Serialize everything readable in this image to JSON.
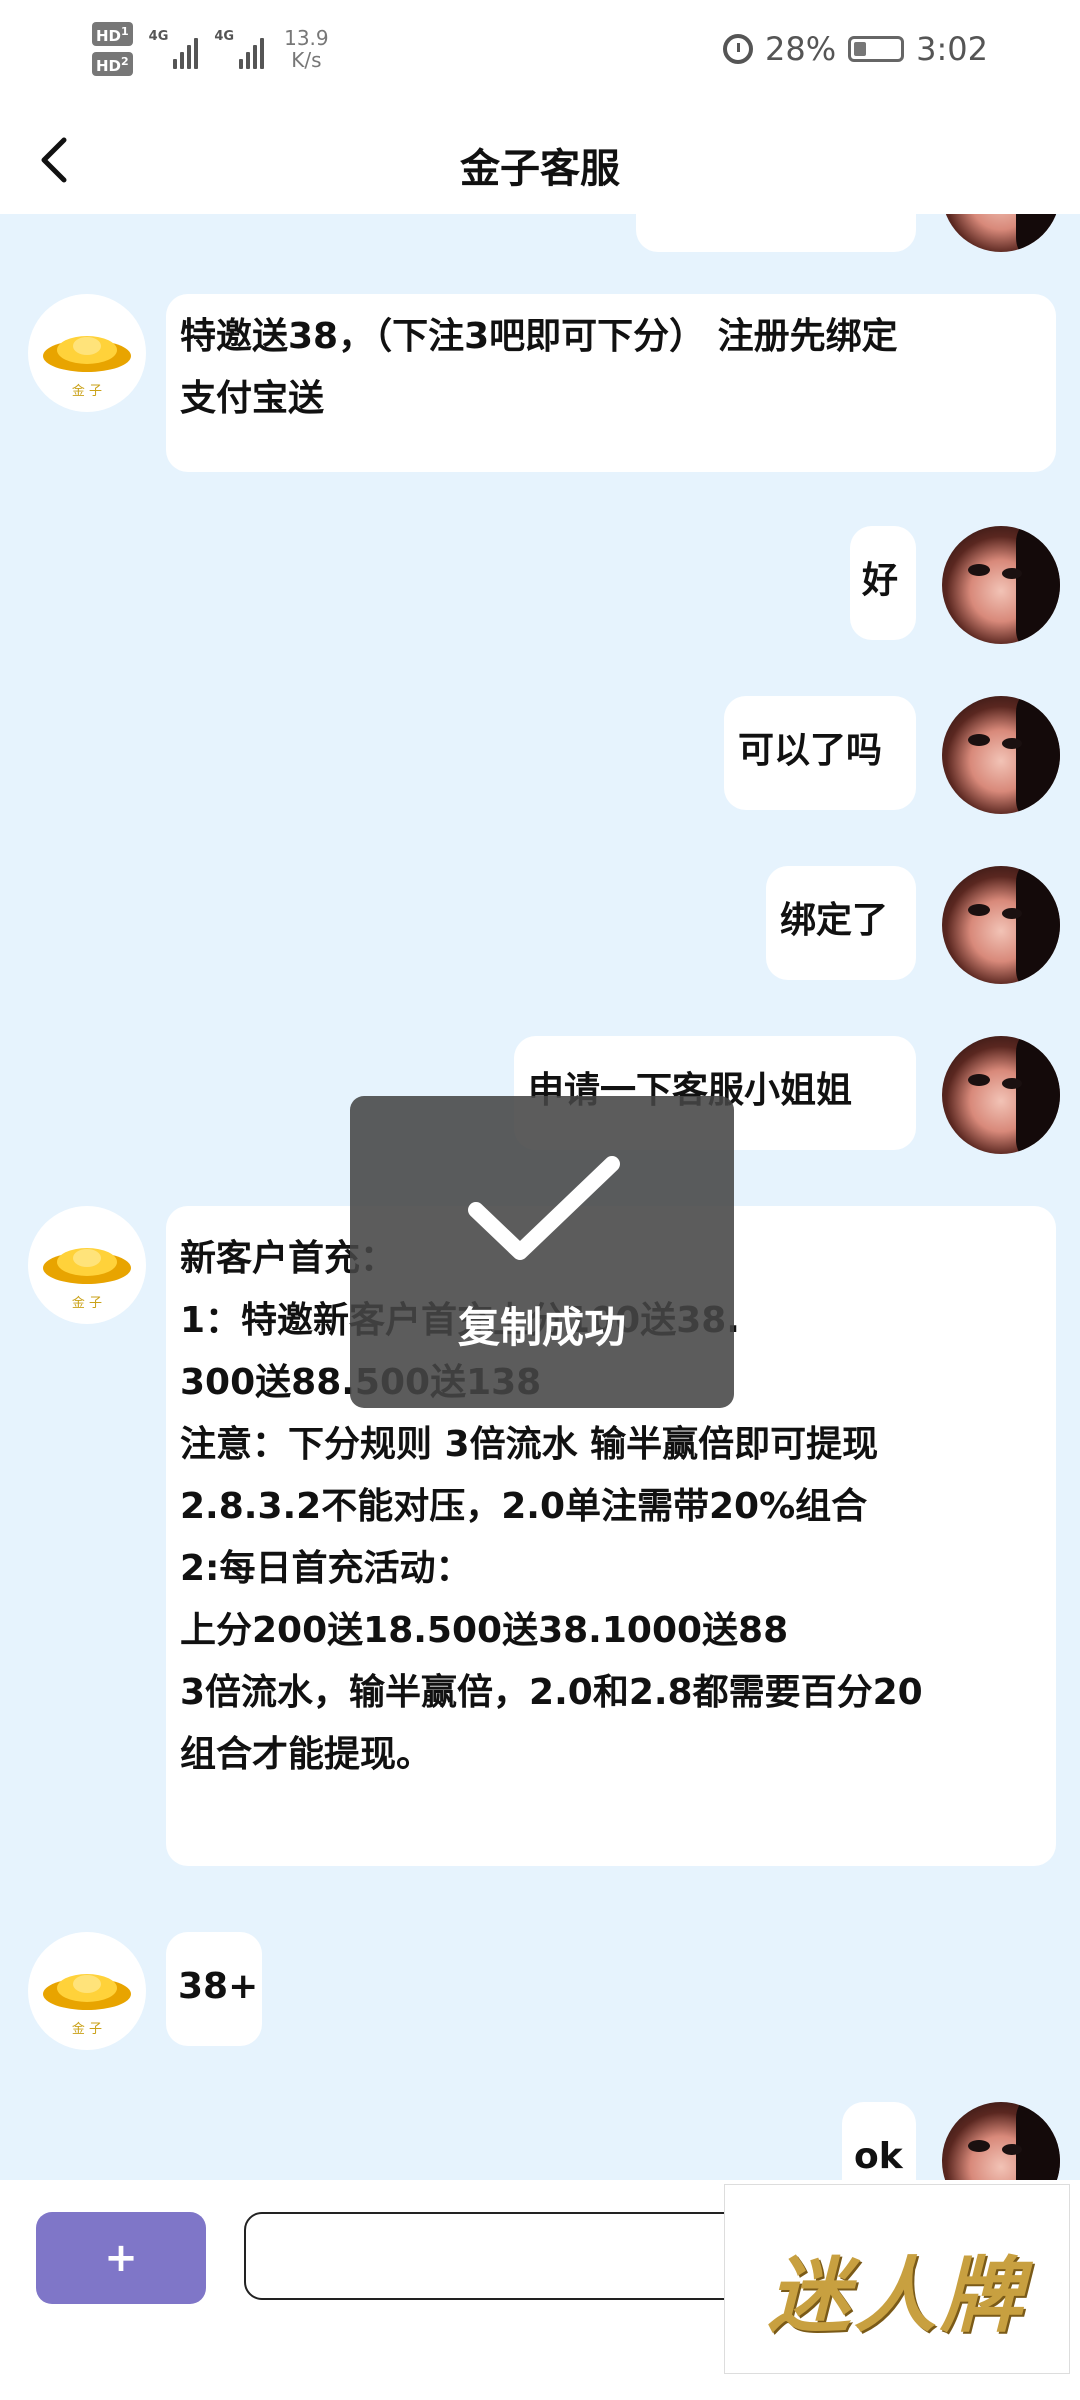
{
  "status_bar": {
    "hd1": "HD",
    "hd1_sub": "1",
    "hd2": "HD",
    "hd2_sub": "2",
    "net1": "4G",
    "net2": "4G",
    "speed_value": "13.9",
    "speed_unit": "K/s",
    "battery_pct": "28%",
    "battery_level": 0.28,
    "time": "3:02"
  },
  "header": {
    "title": "金子客服",
    "back_icon": "chevron-left-icon"
  },
  "avatars": {
    "agent_caption": "金 子"
  },
  "messages": [
    {
      "from": "agent",
      "lines": [
        "特邀送38，（下注3吧即可下分） 注册先绑定",
        "支付宝送"
      ]
    },
    {
      "from": "user",
      "lines": [
        "好"
      ]
    },
    {
      "from": "user",
      "lines": [
        "可以了吗"
      ]
    },
    {
      "from": "user",
      "lines": [
        "绑定了"
      ]
    },
    {
      "from": "user",
      "lines": [
        "申请一下客服小姐姐"
      ]
    },
    {
      "from": "agent",
      "lines": [
        "新客户首充：",
        "1：特邀新客户首充上分100送38.",
        "300送88.500送138",
        "注意：下分规则 3倍流水 输半赢倍即可提现",
        "2.8.3.2不能对压，2.0单注需带20%组合",
        "2:每日首充活动：",
        "上分200送18.500送38.1000送88",
        "3倍流水，输半赢倍，2.0和2.8都需要百分20",
        "组合才能提现。"
      ]
    },
    {
      "from": "agent",
      "lines": [
        "38+"
      ]
    },
    {
      "from": "user",
      "lines": [
        "ok"
      ]
    }
  ],
  "toast": {
    "text": "复制成功",
    "icon": "checkmark-icon"
  },
  "input_bar": {
    "plus_label": "+",
    "input_value": "",
    "input_placeholder": ""
  },
  "watermark": {
    "text": "迷人牌"
  }
}
